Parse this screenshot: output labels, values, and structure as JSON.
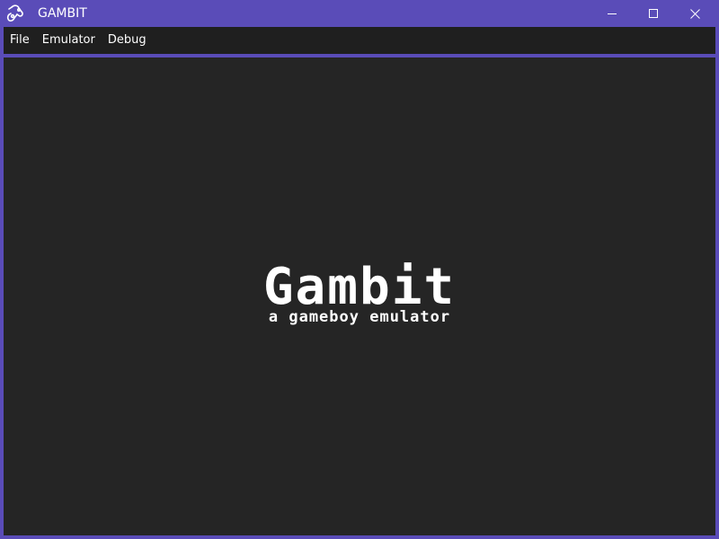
{
  "window": {
    "title": "GAMBIT",
    "icon": "gamepad-icon",
    "controls": {
      "minimize_icon": "minimize-icon",
      "maximize_icon": "maximize-icon",
      "close_icon": "close-icon"
    }
  },
  "menubar": {
    "items": [
      {
        "label": "File"
      },
      {
        "label": "Emulator"
      },
      {
        "label": "Debug"
      }
    ]
  },
  "main": {
    "logo_text": "Gambit",
    "tagline": "a gameboy emulator"
  },
  "colors": {
    "frame": "#5a4cb8",
    "menubar_bg": "#1f1f1f",
    "content_bg": "#252525",
    "text": "#ffffff"
  }
}
